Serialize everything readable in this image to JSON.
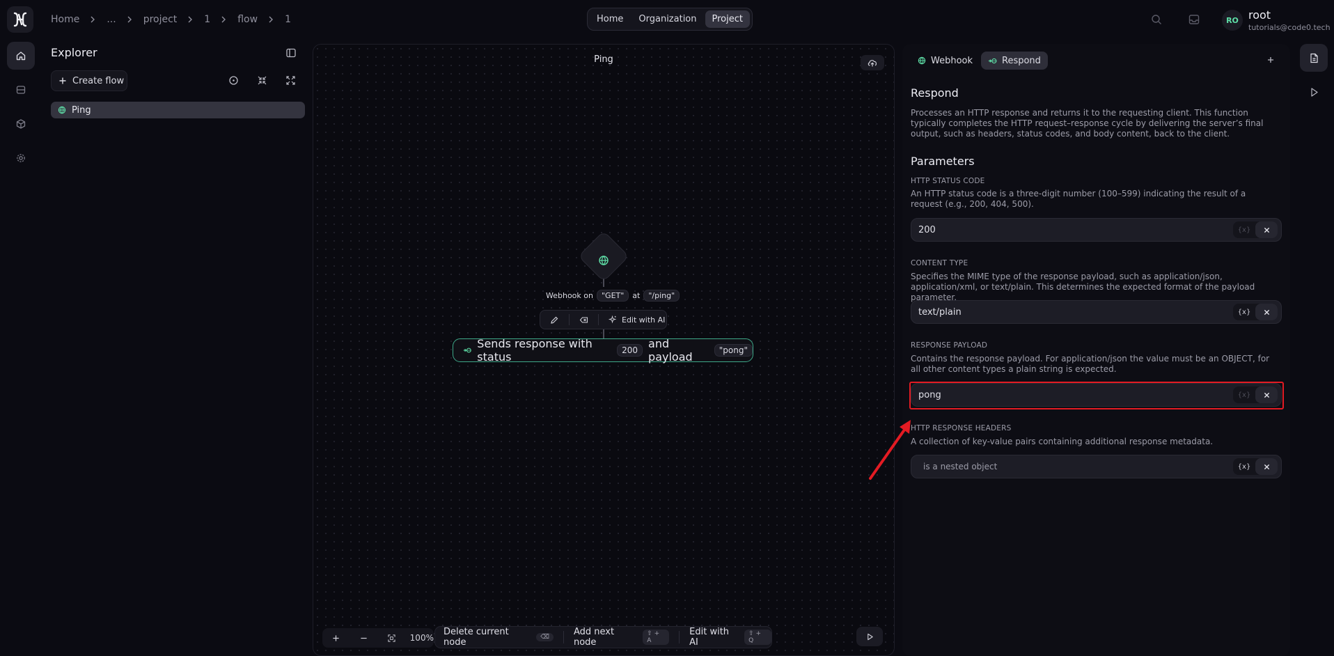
{
  "breadcrumb": [
    "Home",
    "...",
    "project",
    "1",
    "flow",
    "1"
  ],
  "top_nav": [
    {
      "label": "Home",
      "active": false
    },
    {
      "label": "Organization",
      "active": false
    },
    {
      "label": "Project",
      "active": true
    }
  ],
  "user": {
    "initials": "RO",
    "name": "root",
    "email": "tutorials@code0.tech"
  },
  "explorer": {
    "title": "Explorer",
    "create_flow": "Create flow",
    "flows": [
      {
        "label": "Ping",
        "icon": "webhook-icon",
        "selected": true
      }
    ]
  },
  "canvas": {
    "title": "Ping",
    "trigger": {
      "prefix": "Webhook on",
      "method": "\"GET\"",
      "joiner": "at",
      "path": "\"/ping\""
    },
    "node_toolbar": {
      "edit_ai": "Edit with AI"
    },
    "respond_node": {
      "prefix": "Sends response with status",
      "status": "200",
      "joiner": "and payload",
      "payload": "\"pong\""
    },
    "zoom": "100%",
    "actions": [
      {
        "label": "Delete current node",
        "shortcut": "⌫"
      },
      {
        "label": "Add next node",
        "shortcut": "⇧ + A"
      },
      {
        "label": "Edit with AI",
        "shortcut": "⇧ + Q"
      }
    ]
  },
  "panel": {
    "tabs": [
      {
        "label": "Webhook",
        "icon": "webhook-icon",
        "active": false
      },
      {
        "label": "Respond",
        "icon": "respond-icon",
        "active": true
      }
    ],
    "title": "Respond",
    "description": "Processes an HTTP response and returns it to the requesting client. This function typically completes the HTTP request–response cycle by delivering the server’s final output, such as headers, status codes, and body content, back to the client.",
    "parameters_title": "Parameters",
    "params": [
      {
        "label": "HTTP STATUS CODE",
        "description": "An HTTP status code is a three-digit number (100–599) indicating the result of a request (e.g., 200, 404, 500).",
        "value": "200",
        "variable_btn": "{x}",
        "variable_enabled": false
      },
      {
        "label": "CONTENT TYPE",
        "description": "Specifies the MIME type of the response payload, such as application/json, application/xml, or text/plain. This determines the expected format of the payload parameter.",
        "value": "text/plain",
        "variable_btn": "{x}",
        "variable_enabled": true
      },
      {
        "label": "RESPONSE PAYLOAD",
        "description": "Contains the response payload. For application/json the value must be an OBJECT, for all other content types a plain string is expected.",
        "value": "pong",
        "variable_btn": "{x}",
        "variable_enabled": false
      },
      {
        "label": "HTTP RESPONSE HEADERS",
        "description": "A collection of key-value pairs containing additional response metadata.",
        "value": "is a nested object",
        "variable_btn": "{x}",
        "variable_enabled": true
      }
    ]
  },
  "colors": {
    "accent": "#3ea889",
    "highlight": "#e31b23",
    "avatar_text": "#5fe0a8"
  }
}
